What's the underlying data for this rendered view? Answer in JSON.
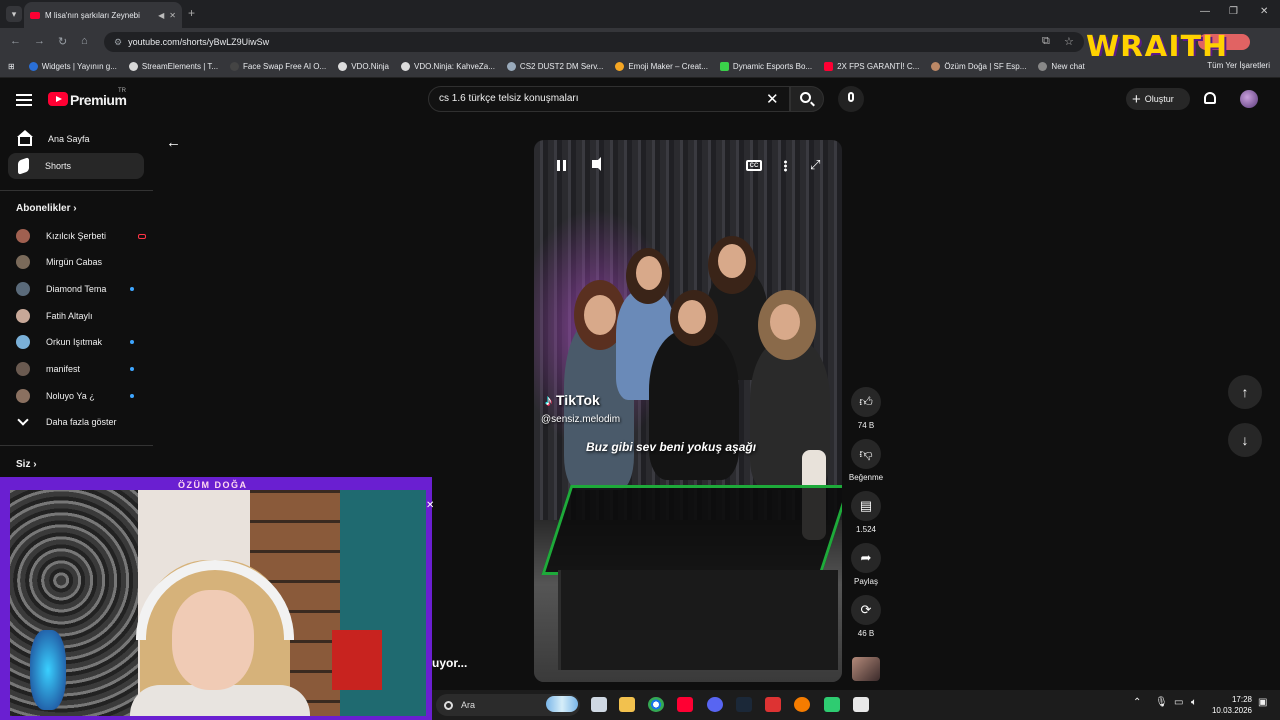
{
  "browser": {
    "tab_title": "M lisa'nın şarkıları Zeynebi",
    "url": "youtube.com/shorts/yBwLZ9UiwSw",
    "bookmarks": [
      "Widgets | Yayının g...",
      "StreamElements | T...",
      "Face Swap Free AI O...",
      "VDO.Ninja",
      "VDO.Ninja: KahveZa...",
      "CS2 DUST2 DM Serv...",
      "Emoji Maker – Creat...",
      "Dynamic Esports Bo...",
      "2X FPS GARANTİ! C...",
      "Özüm Doğa | SF Esp...",
      "New chat"
    ],
    "bookmarks_right": "Tüm Yer İşaretleri"
  },
  "overlay_brand": "WRAITH",
  "youtube": {
    "brand": "Premium",
    "country": "TR",
    "search_value": "cs 1.6 türkçe telsiz konuşmaları",
    "create_label": "Oluştur"
  },
  "sidebar": {
    "home": "Ana Sayfa",
    "shorts": "Shorts",
    "subs_heading": "Abonelikler",
    "subscriptions": [
      {
        "name": "Kızılcık Şerbeti",
        "status": "live"
      },
      {
        "name": "Mirgün Cabas",
        "status": "none"
      },
      {
        "name": "Diamond Tema",
        "status": "new"
      },
      {
        "name": "Fatih Altaylı",
        "status": "none"
      },
      {
        "name": "Orkun Işıtmak",
        "status": "new"
      },
      {
        "name": "manifest",
        "status": "new"
      },
      {
        "name": "Noluyo Ya ¿",
        "status": "new"
      }
    ],
    "show_more": "Daha fazla göster",
    "you_heading": "Siz"
  },
  "video": {
    "tiktok_brand": "TikTok",
    "tiktok_user": "@sensiz.melodim",
    "subtitle": "Buz gibi sev beni yokuş aşağı"
  },
  "actions": {
    "like_count": "74 B",
    "dislike_label": "Beğenme",
    "comment_count": "1.524",
    "share_label": "Paylaş",
    "remix_count": "46 B"
  },
  "stream": {
    "name": "ÖZÜM DOĞA",
    "caption": "uyor..."
  },
  "taskbar": {
    "search_label": "Ara",
    "time": "17:28",
    "date": "10.03.2026"
  },
  "colors": {
    "accent_red": "#ff0033",
    "overlay_purple": "#6a1fd1",
    "wraith_yellow": "#ffd200",
    "table_green": "#1eaa3a"
  }
}
